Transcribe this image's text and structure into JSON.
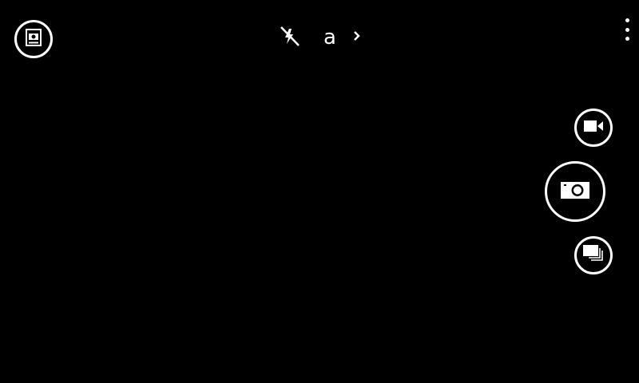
{
  "app": {
    "background": "#000000",
    "foreground": "#ffffff"
  },
  "top_bar": {
    "switch_camera_icon": "switch-camera-icon",
    "flash_icon": "flash-off-icon",
    "mode_label": "a",
    "mode_chevron_icon": "chevron-right-icon",
    "overflow_icon": "more-vert-icon"
  },
  "side_controls": {
    "video_icon": "video-camera-icon",
    "shutter_icon": "camera-icon",
    "gallery_icon": "gallery-icon"
  }
}
